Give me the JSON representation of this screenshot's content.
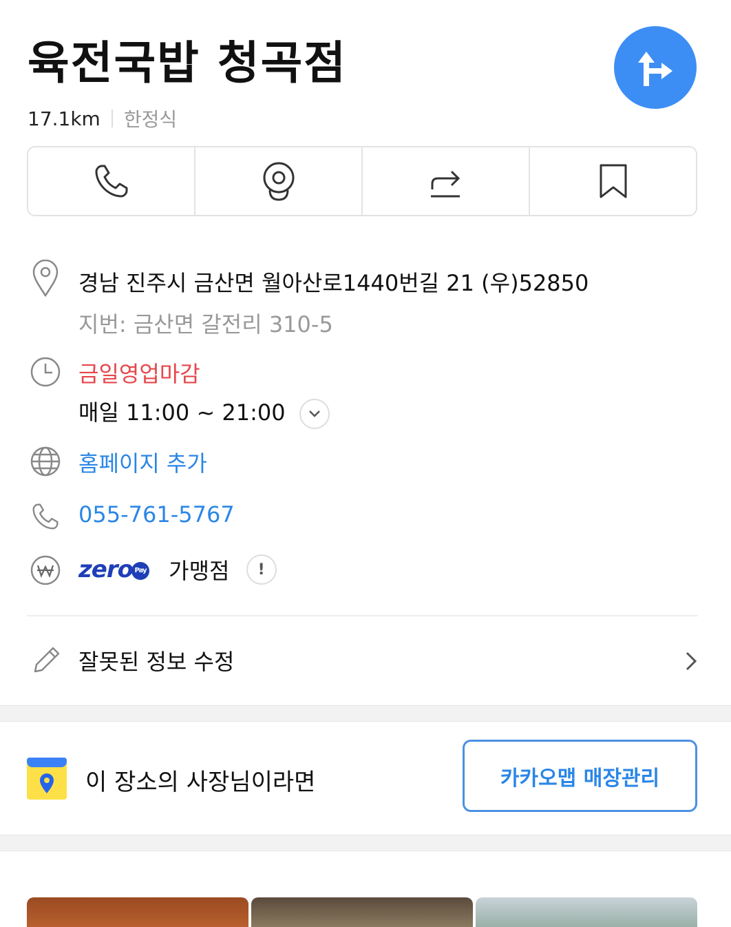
{
  "place": {
    "name": "육전국밥 청곡점",
    "distance": "17.1km",
    "category": "한정식"
  },
  "route_button": {
    "icon": "directions-icon"
  },
  "actions": [
    {
      "id": "call",
      "icon": "phone-icon"
    },
    {
      "id": "roadview",
      "icon": "roadview-camera-icon"
    },
    {
      "id": "share",
      "icon": "share-icon"
    },
    {
      "id": "save",
      "icon": "bookmark-icon"
    }
  ],
  "address": {
    "road": "경남 진주시 금산면 월아산로1440번길 21 (우)52850",
    "lot": "지번: 금산면 갈전리 310-5"
  },
  "hours": {
    "status": "금일영업마감",
    "schedule": "매일 11:00 ~ 21:00"
  },
  "homepage": {
    "label": "홈페이지 추가"
  },
  "phone": {
    "number": "055-761-5767"
  },
  "zeropay": {
    "logo_text": "zero",
    "logo_badge": "Pay",
    "label": "가맹점",
    "info": "!"
  },
  "edit_info": {
    "label": "잘못된 정보 수정"
  },
  "owner": {
    "text": "이 장소의 사장님이라면",
    "button": "카카오맵 매장관리"
  },
  "colors": {
    "accent_blue": "#3d8ef4",
    "closed_red": "#e5474c",
    "link_blue": "#2a86e6",
    "zeropay_navy": "#1f3fb8"
  }
}
